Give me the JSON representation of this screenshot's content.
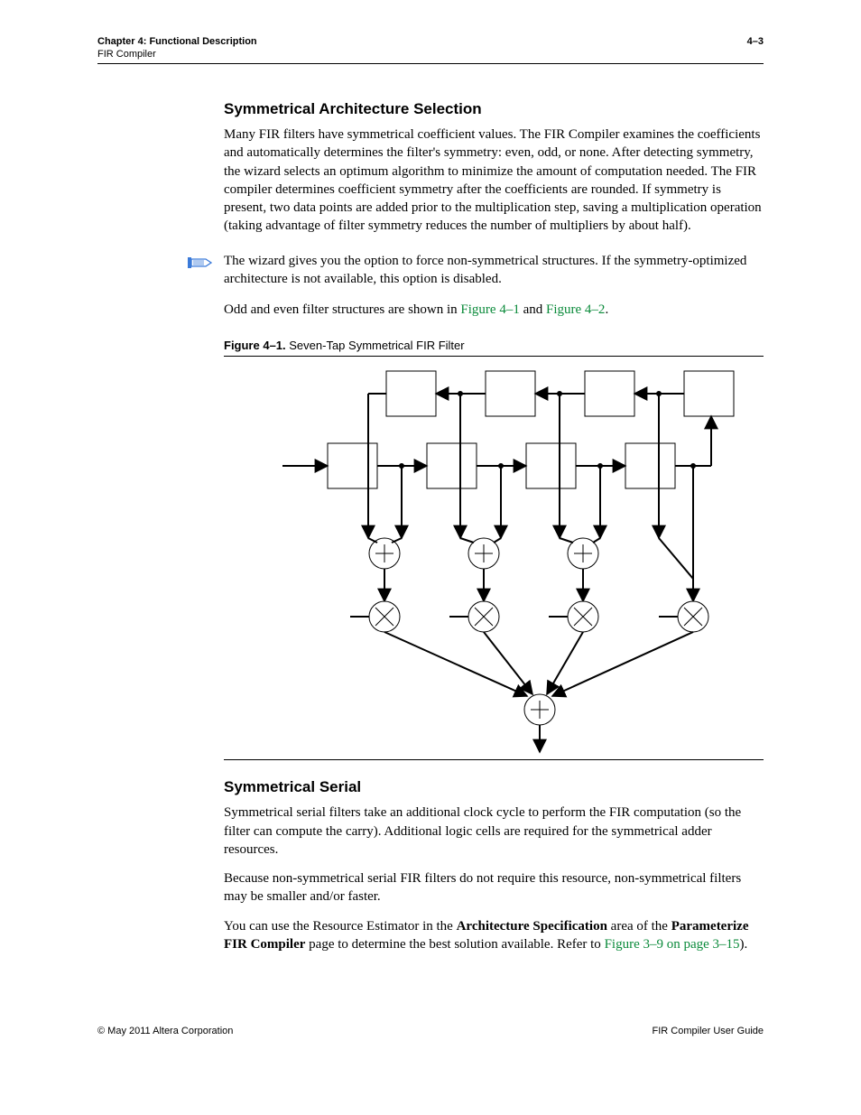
{
  "header": {
    "chapter": "Chapter 4:  Functional Description",
    "pagenum": "4–3",
    "subtitle": "FIR Compiler"
  },
  "sec1": {
    "title": "Symmetrical Architecture Selection",
    "p1": "Many FIR filters have symmetrical coefficient values. The FIR Compiler examines the coefficients and automatically determines the filter's symmetry: even, odd, or none. After detecting symmetry, the wizard selects an optimum algorithm to minimize the amount of computation needed. The FIR compiler determines coefficient symmetry after the coefficients are rounded. If symmetry is present, two data points are added prior to the multiplication step, saving a multiplication operation (taking advantage of filter symmetry reduces the number of multipliers by about half).",
    "note": {
      "pre": "The wizard gives you the option to force non-symmetrical structures. If the symmetry-optimized architecture is not available, this option is disabled."
    },
    "p2_pre": "Odd and even filter structures are shown in ",
    "p2_link1": "Figure 4–1",
    "p2_mid": " and ",
    "p2_link2": "Figure 4–2",
    "p2_post": "."
  },
  "figure": {
    "label": "Figure 4–1.",
    "caption": "Seven-Tap Symmetrical FIR Filter"
  },
  "sec2": {
    "title": "Symmetrical Serial",
    "p1": "Symmetrical serial filters take an additional clock cycle to perform the FIR computation (so the filter can compute the carry). Additional logic cells are required for the symmetrical adder resources.",
    "p2": "Because non-symmetrical serial FIR filters do not require this resource, non-symmetrical filters may be smaller and/or faster.",
    "p3_pre": "You can use the Resource Estimator in the ",
    "p3_bold1": "Architecture Specification",
    "p3_mid1": " area of the ",
    "p3_bold2": "Parameterize FIR Compiler",
    "p3_mid2": " page to determine the best solution available. Refer to ",
    "p3_link": "Figure 3–9 on page 3–15",
    "p3_post": ")."
  },
  "footer": {
    "left": "© May 2011   Altera Corporation",
    "right": "FIR Compiler User Guide"
  }
}
